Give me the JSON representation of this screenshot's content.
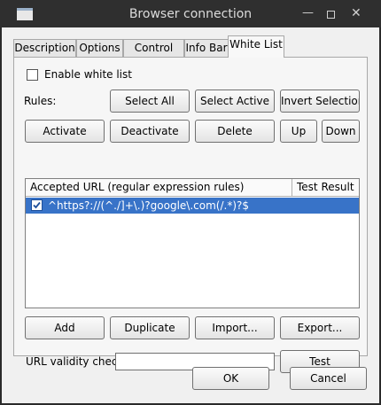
{
  "window": {
    "title": "Browser connection"
  },
  "titlebar": {
    "minimize": "—",
    "close": "✕"
  },
  "tabs": [
    {
      "label": "Description"
    },
    {
      "label": "Options"
    },
    {
      "label": "Control Bar"
    },
    {
      "label": "Info Bar"
    },
    {
      "label": "White List"
    }
  ],
  "active_tab": "White List",
  "whitelist": {
    "enable_label": "Enable white list",
    "enable_checked": false,
    "rules_label": "Rules:",
    "buttons_row1": {
      "select_all": "Select All",
      "select_active": "Select Active",
      "invert_selection": "Invert Selection"
    },
    "buttons_row2": {
      "activate": "Activate",
      "deactivate": "Deactivate",
      "delete": "Delete",
      "up": "Up",
      "down": "Down"
    },
    "columns": {
      "url": "Accepted URL (regular expression rules)",
      "test": "Test Result"
    },
    "rows": [
      {
        "checked": true,
        "url": "^https?://(^./]+\\.)?google\\.com(/.*)?$",
        "test": ""
      }
    ],
    "buttons_row3": {
      "add": "Add",
      "duplicate": "Duplicate",
      "import": "Import...",
      "export": "Export..."
    },
    "validity_label": "URL validity check",
    "validity_value": "",
    "test_button": "Test"
  },
  "dialog": {
    "ok": "OK",
    "cancel": "Cancel"
  },
  "colors": {
    "selection": "#3873c8",
    "titlebar": "#2f2f2f"
  }
}
